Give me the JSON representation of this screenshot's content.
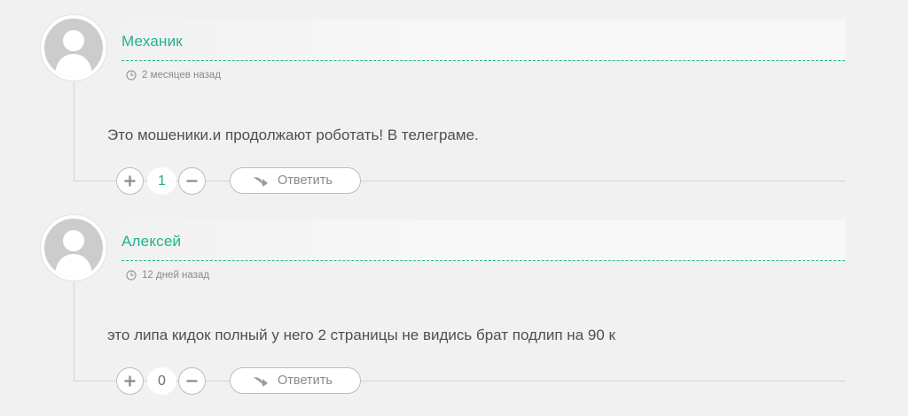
{
  "comments": [
    {
      "author": "Механик",
      "time": "2 месяцев назад",
      "text": "Это мошеники.и продолжают роботать! В телеграме.",
      "votes": "1",
      "reply_label": "Ответить"
    },
    {
      "author": "Алексей",
      "time": "12 дней назад",
      "text": "это липа кидок полный у него 2 страницы не видись брат подлип на 90 к",
      "votes": "0",
      "reply_label": "Ответить"
    }
  ],
  "colors": {
    "accent": "#21b28f",
    "background": "#f1f1f1",
    "text": "#4f4f4f",
    "muted": "#8a8a8a"
  },
  "icons": {
    "avatar": "default-user-avatar",
    "time": "clock-icon",
    "upvote": "plus-icon",
    "downvote": "minus-icon",
    "reply": "reply-arrow-icon"
  }
}
